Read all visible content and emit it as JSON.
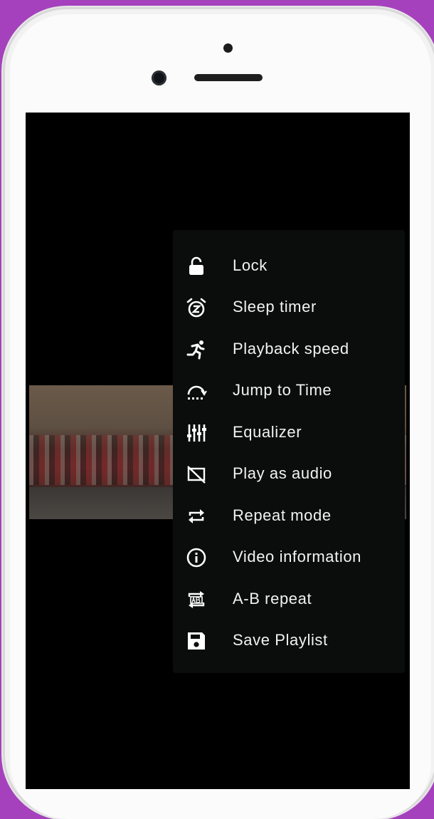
{
  "theme": {
    "background": "#a541bd",
    "menu_background": "#0b0d0c",
    "menu_text": "#f2f2f2"
  },
  "menu": {
    "items": [
      {
        "label": "Lock",
        "icon": "lock-icon"
      },
      {
        "label": "Sleep timer",
        "icon": "sleep-timer-icon"
      },
      {
        "label": "Playback speed",
        "icon": "playback-speed-icon"
      },
      {
        "label": "Jump to Time",
        "icon": "jump-to-time-icon"
      },
      {
        "label": "Equalizer",
        "icon": "equalizer-icon"
      },
      {
        "label": "Play as audio",
        "icon": "play-as-audio-icon"
      },
      {
        "label": "Repeat mode",
        "icon": "repeat-icon"
      },
      {
        "label": "Video information",
        "icon": "info-icon"
      },
      {
        "label": "A-B repeat",
        "icon": "ab-repeat-icon"
      },
      {
        "label": "Save Playlist",
        "icon": "save-icon"
      }
    ]
  }
}
